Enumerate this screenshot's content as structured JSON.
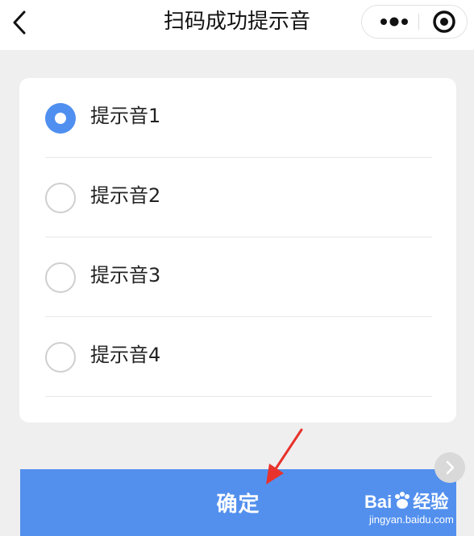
{
  "nav": {
    "title": "扫码成功提示音",
    "icons": [
      "back-chevron-icon",
      "more-dots-icon",
      "target-circle-icon"
    ]
  },
  "options": [
    {
      "label": "提示音1",
      "checked": true
    },
    {
      "label": "提示音2",
      "checked": false
    },
    {
      "label": "提示音3",
      "checked": false
    },
    {
      "label": "提示音4",
      "checked": false
    }
  ],
  "confirm": {
    "label": "确定"
  },
  "watermark": {
    "brand": "Bai",
    "brand_cn": "经验",
    "site": "jingyan.baidu.com"
  },
  "colors": {
    "accent": "#5390ee",
    "radio_checked": "#4f8ff0",
    "arrow": "#e8322c"
  }
}
